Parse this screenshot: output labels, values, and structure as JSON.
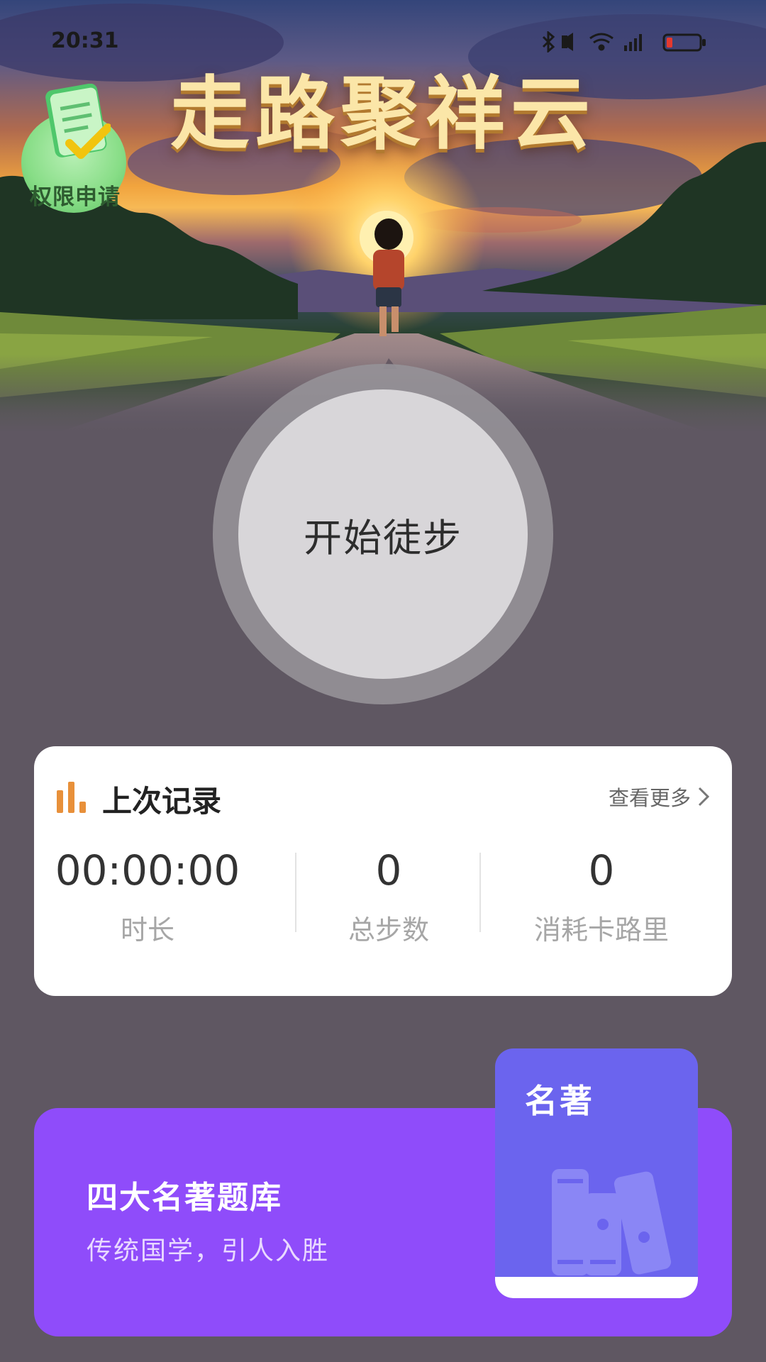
{
  "status_bar": {
    "time": "20:31",
    "icons": [
      "bluetooth-icon",
      "mute-icon",
      "wifi-icon",
      "signal-icon",
      "battery-icon"
    ]
  },
  "header": {
    "title": "走路聚祥云",
    "permission_badge_label": "权限申请",
    "permission_badge_icon": "checklist-icon"
  },
  "start": {
    "label": "开始徒步"
  },
  "last_record": {
    "title": "上次记录",
    "icon": "bar-chart-icon",
    "view_more": "查看更多",
    "stats": [
      {
        "value": "00:00:00",
        "label": "时长"
      },
      {
        "value": "0",
        "label": "总步数"
      },
      {
        "value": "0",
        "label": "消耗卡路里"
      }
    ]
  },
  "quiz": {
    "title": "四大名著题库",
    "subtitle": "传统国学，引人入胜",
    "card_label": "名著",
    "card_icon": "books-icon"
  },
  "colors": {
    "page_background": "#5f5762",
    "title_gold": "#fbe6a8",
    "record_icon_orange": "#e8903a",
    "quiz_purple": "#8f4cfa",
    "classic_card_blue": "#6b64ee"
  }
}
